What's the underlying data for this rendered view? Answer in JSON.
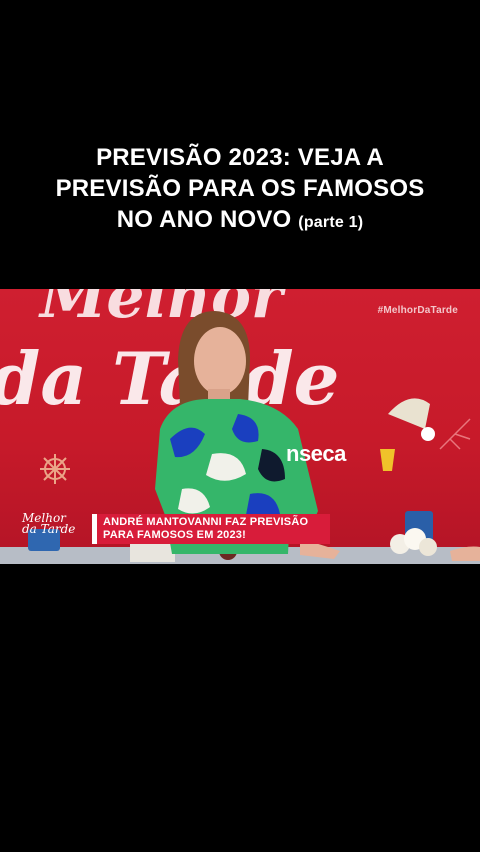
{
  "headline": {
    "line1": "PREVISÃO 2023: VEJA A",
    "line2": "PREVISÃO PARA OS FAMOSOS",
    "line3_main": "NO ANO NOVO",
    "line3_small": "(parte 1)"
  },
  "video": {
    "hashtag": "#MelhorDaTarde",
    "set_text": "nseca",
    "logo_line1": "Melhor",
    "logo_line2": "da Tarde",
    "lower_third_line1": "ANDRÉ MANTOVANNI FAZ PREVISÃO",
    "lower_third_line2": "PARA FAMOSOS EM 2023!"
  },
  "colors": {
    "background": "#000000",
    "set_red": "#cf1f30",
    "lower_third": "#d81c3a"
  }
}
